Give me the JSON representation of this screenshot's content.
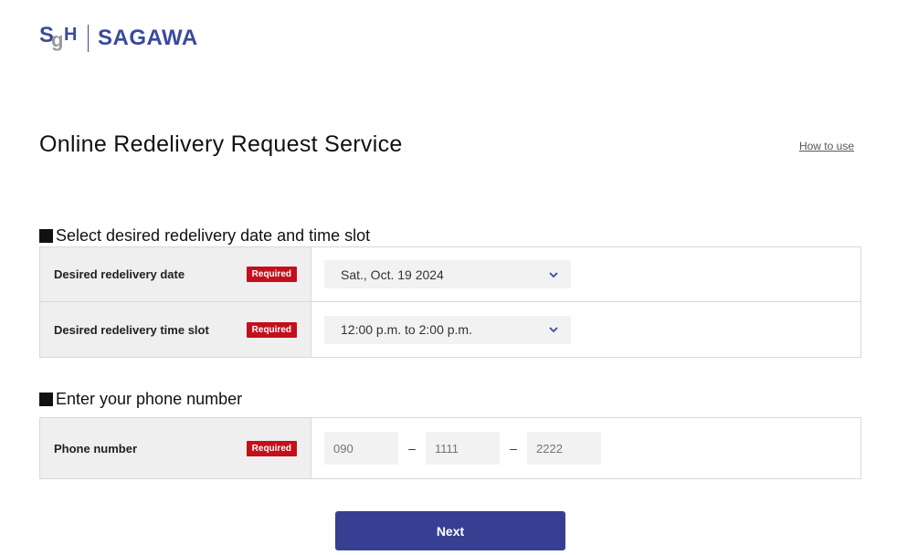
{
  "header": {
    "logo_letters": {
      "s": "S",
      "g": "g",
      "h": "H"
    },
    "brand": "SAGAWA"
  },
  "page": {
    "title": "Online Redelivery Request Service",
    "how_to_use": "How to use"
  },
  "section1": {
    "heading": "Select desired redelivery date and time slot",
    "rows": [
      {
        "label": "Desired redelivery date",
        "required": "Required",
        "value": "Sat., Oct. 19 2024"
      },
      {
        "label": "Desired redelivery time slot",
        "required": "Required",
        "value": "12:00 p.m. to 2:00 p.m."
      }
    ]
  },
  "section2": {
    "heading": "Enter your phone number",
    "label": "Phone number",
    "required": "Required",
    "placeholders": [
      "090",
      "1111",
      "2222"
    ],
    "separator": "–"
  },
  "actions": {
    "next_label": "Next"
  },
  "colors": {
    "brand_blue": "#373f92",
    "required_red": "#c40f1c"
  }
}
